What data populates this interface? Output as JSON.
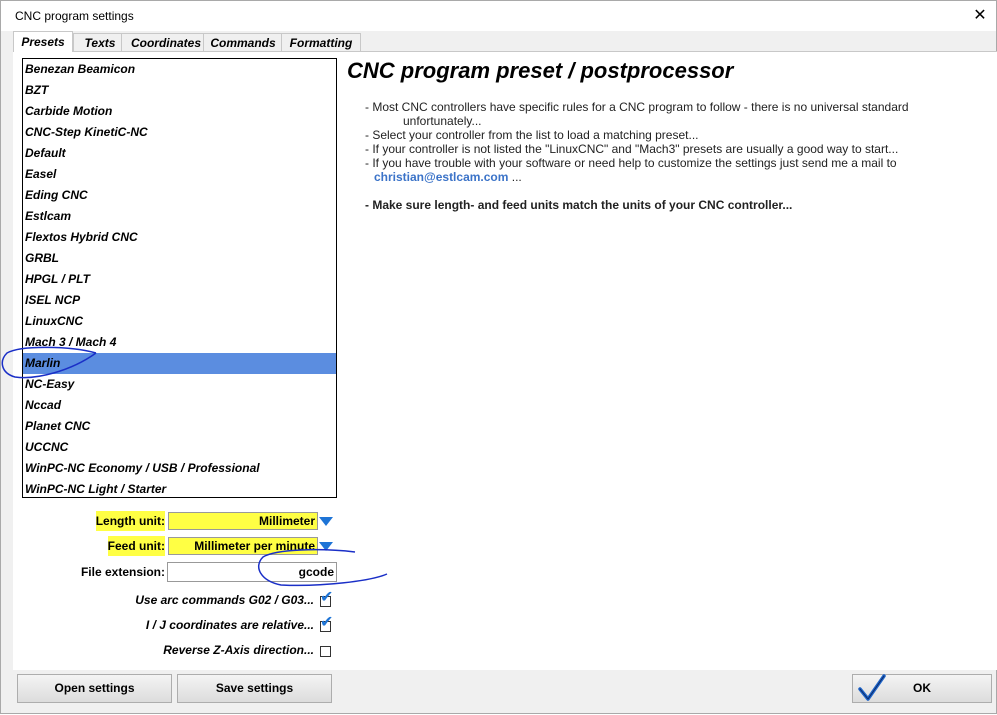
{
  "window": {
    "title": "CNC program settings",
    "close_glyph": "✕"
  },
  "tabs": [
    {
      "label": "Presets",
      "active": true
    },
    {
      "label": "Texts"
    },
    {
      "label": "Coordinates"
    },
    {
      "label": "Commands"
    },
    {
      "label": "Formatting"
    }
  ],
  "presets": {
    "selected_index": 14,
    "items": [
      "Benezan Beamicon",
      "BZT",
      "Carbide Motion",
      "CNC-Step KinetiC-NC",
      "Default",
      "Easel",
      "Eding CNC",
      "Estlcam",
      "Flextos Hybrid CNC",
      "GRBL",
      "HPGL / PLT",
      "ISEL NCP",
      "LinuxCNC",
      "Mach 3 / Mach 4",
      "Marlin",
      "NC-Easy",
      "Nccad",
      "Planet CNC",
      "UCCNC",
      "WinPC-NC Economy / USB / Professional",
      "WinPC-NC Light / Starter"
    ]
  },
  "info": {
    "heading": "CNC program preset / postprocessor",
    "line1a": "- Most CNC controllers have specific rules for a CNC program to follow - there is no universal standard",
    "line1b": "unfortunately...",
    "line2": "- Select your controller from the list to load a matching preset...",
    "line3": "- If your controller is not listed the \"LinuxCNC\" and \"Mach3\" presets are usually a good way to start...",
    "line4": "- If you have trouble with your software or need help to customize the settings just send me a mail to",
    "email": "christian@estlcam.com",
    "ellipsis": "...",
    "warning": "- Make sure length- and feed units match the units of your CNC controller..."
  },
  "fields": {
    "length_unit": {
      "label": "Length unit:",
      "value": "Millimeter"
    },
    "feed_unit": {
      "label": "Feed unit:",
      "value": "Millimeter per minute"
    },
    "file_extension": {
      "label": "File extension:",
      "value": "gcode"
    }
  },
  "checks": {
    "arc": {
      "label": "Use arc commands G02 / G03...",
      "checked": true
    },
    "ij": {
      "label": "I / J coordinates are relative...",
      "checked": true
    },
    "reverse_z": {
      "label": "Reverse Z-Axis direction...",
      "checked": false
    },
    "check_glyph": "✔"
  },
  "buttons": {
    "open": "Open settings",
    "save": "Save settings",
    "ok": "OK"
  },
  "colors": {
    "highlight": "#ffff44",
    "selection": "#5b8de0",
    "accent": "#1e74d6",
    "annotation_ink": "#1a2fc7"
  }
}
